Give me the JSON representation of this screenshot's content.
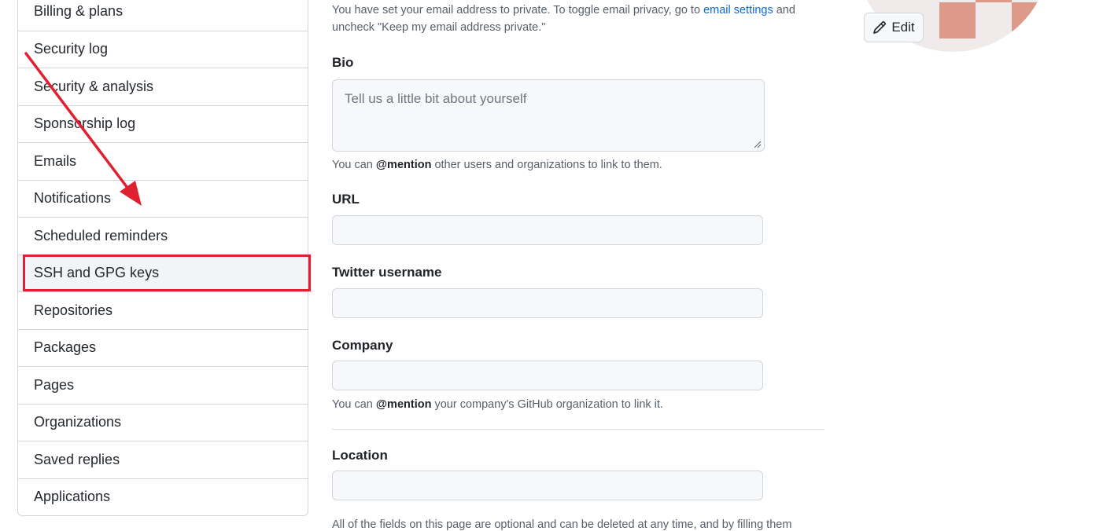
{
  "sidebar": {
    "items": [
      {
        "label": "Billing & plans"
      },
      {
        "label": "Security log"
      },
      {
        "label": "Security & analysis"
      },
      {
        "label": "Sponsorship log"
      },
      {
        "label": "Emails"
      },
      {
        "label": "Notifications"
      },
      {
        "label": "Scheduled reminders"
      },
      {
        "label": "SSH and GPG keys"
      },
      {
        "label": "Repositories"
      },
      {
        "label": "Packages"
      },
      {
        "label": "Pages"
      },
      {
        "label": "Organizations"
      },
      {
        "label": "Saved replies"
      },
      {
        "label": "Applications"
      }
    ]
  },
  "form": {
    "email_note_prefix": "You have set your email address to private. To toggle email privacy, go to ",
    "email_note_link": "email settings",
    "email_note_suffix": " and uncheck \"Keep my email address private.\"",
    "bio_label": "Bio",
    "bio_placeholder": "Tell us a little bit about yourself",
    "bio_help_prefix": "You can ",
    "bio_help_mention": "@mention",
    "bio_help_suffix": " other users and organizations to link to them.",
    "url_label": "URL",
    "twitter_label": "Twitter username",
    "company_label": "Company",
    "company_help_prefix": "You can ",
    "company_help_mention": "@mention",
    "company_help_suffix": " your company's GitHub organization to link it.",
    "location_label": "Location",
    "footer_note": "All of the fields on this page are optional and can be deleted at any time, and by filling them"
  },
  "avatar": {
    "edit_label": "Edit"
  },
  "colors": {
    "highlight": "#e02030",
    "link": "#0969da"
  }
}
